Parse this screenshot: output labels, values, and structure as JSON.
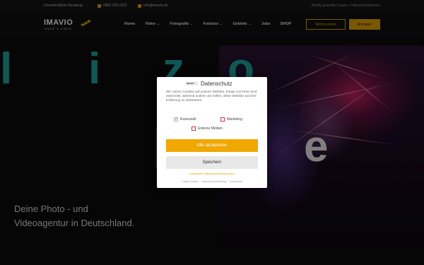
{
  "topbar": {
    "consult": "Unverbindliche Beratung",
    "phone": "0800 700 2323",
    "email": "info@imavio.de",
    "right_links": "Häufig gestellte Fragen | Videoproduktionen"
  },
  "header": {
    "logo_word": "IMAVIO",
    "logo_sub": "IMAGE & VIDEO",
    "nav": [
      {
        "label": "Home",
        "dropdown": false
      },
      {
        "label": "Video",
        "dropdown": true
      },
      {
        "label": "Fotografie",
        "dropdown": true
      },
      {
        "label": "Fotobox",
        "dropdown": true
      },
      {
        "label": "Gebiete",
        "dropdown": true
      },
      {
        "label": "Jobs",
        "dropdown": false
      },
      {
        "label": "SHOP",
        "dropdown": false
      }
    ],
    "btn_outline": "Termin prüfen",
    "btn_fill": "Anfragen",
    "accent": "#e0a100"
  },
  "hero": {
    "tagline_line1": "Deine Photo - und",
    "tagline_line2": "Videoagentur in Deutschland.",
    "accent_teal": "#1aa39a"
  },
  "cookie": {
    "logo_text": "IMAVIO",
    "title": "Datenschutz",
    "text": "Wir nutzen Cookies auf unserer Website. Einige von ihnen sind essenziell, während andere uns helfen, diese Website und Ihre Erfahrung zu verbessern.",
    "options": {
      "essential": "Essenziell",
      "marketing": "Marketing",
      "external": "Externe Medien"
    },
    "accept_all": "Alle akzeptieren",
    "save": "Speichern",
    "individual": "Individuelle Datenschutzeinstellungen",
    "footer": {
      "details": "Cookie-Details",
      "privacy": "Datenschutzerklärung",
      "imprint": "Impressum"
    },
    "accent": "#f0a800"
  }
}
